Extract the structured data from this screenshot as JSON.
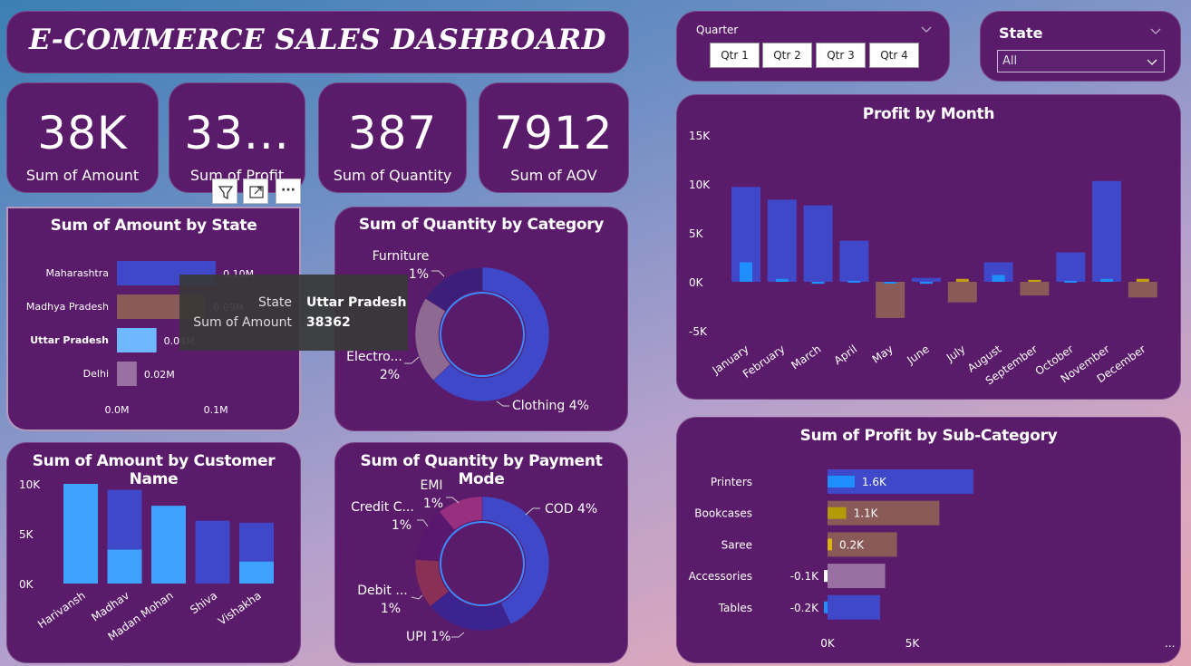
{
  "title": "E-COMMERCE SALES DASHBOARD",
  "kpis": [
    {
      "value": "38K",
      "label": "Sum of Amount"
    },
    {
      "value": "33...",
      "label": "Sum of Profit"
    },
    {
      "value": "387",
      "label": "Sum of Quantity"
    },
    {
      "value": "7912",
      "label": "Sum of AOV"
    }
  ],
  "slicers": {
    "quarter": {
      "label": "Quarter",
      "options": [
        "Qtr 1",
        "Qtr 2",
        "Qtr 3",
        "Qtr 4"
      ]
    },
    "state": {
      "label": "State",
      "selected": "All"
    }
  },
  "visual_header": {
    "icons": [
      "filter-icon",
      "focus-mode-icon",
      "more-options-icon"
    ],
    "more_glyph": "···"
  },
  "tooltip": {
    "k1": "State",
    "v1": "Uttar Pradesh",
    "k2": "Sum of Amount",
    "v2": "38362"
  },
  "accent_colors": {
    "card": "#5a1b6b",
    "bar_blue": "#3f48c9",
    "bar_light": "#40a2ff",
    "bar_brown": "#8a5a58",
    "bar_gold": "#b59a08"
  },
  "chart_data": [
    {
      "id": "amount_by_state",
      "type": "bar",
      "title": "Sum of Amount by State",
      "categories": [
        "Maharashtra",
        "Madhya Pradesh",
        "Uttar Pradesh",
        "Delhi"
      ],
      "values": [
        0.1,
        0.09,
        0.04,
        0.02
      ],
      "data_labels": [
        "0.10M",
        "0.09M",
        "0.04M",
        "0.02M"
      ],
      "highlighted": "Uttar Pradesh",
      "xticks": [
        "0.0M",
        "0.1M"
      ],
      "xlim": [
        0,
        0.11
      ]
    },
    {
      "id": "quantity_by_category",
      "type": "pie",
      "title": "Sum of Quantity by Category",
      "slices": [
        {
          "label": "Clothing",
          "pct": "4%",
          "value": 63,
          "color": "#3f48c9"
        },
        {
          "label": "Electro...",
          "pct": "2%",
          "value": 21,
          "color": "#8e6a92"
        },
        {
          "label": "Furniture",
          "pct": "1%",
          "value": 16,
          "color": "#3d1f7a"
        }
      ]
    },
    {
      "id": "profit_by_month",
      "type": "bar",
      "title": "Profit by Month",
      "categories": [
        "January",
        "February",
        "March",
        "April",
        "May",
        "June",
        "July",
        "August",
        "September",
        "October",
        "November",
        "December"
      ],
      "series": [
        {
          "values": [
            9700,
            8400,
            7800,
            4200,
            -3700,
            400,
            -2100,
            2000,
            -1400,
            3000,
            10300,
            -1600
          ]
        },
        {
          "values": [
            2000,
            300,
            -200,
            100,
            0,
            -200,
            300,
            700,
            200,
            100,
            300,
            300
          ]
        }
      ],
      "yticks": [
        "15K",
        "10K",
        "5K",
        "0K",
        "-5K"
      ],
      "ylim": [
        -5000,
        15000
      ]
    },
    {
      "id": "amount_by_customer",
      "type": "bar",
      "title": "Sum of Amount by Customer Name",
      "categories": [
        "Harivansh",
        "Madhav",
        "Madan Mohan",
        "Shiva",
        "Vishakha"
      ],
      "series": [
        {
          "values": [
            10000,
            9400,
            7800,
            6300,
            6100
          ]
        },
        {
          "values": [
            10000,
            3400,
            7800,
            0,
            2200
          ]
        }
      ],
      "yticks": [
        "10K",
        "5K",
        "0K"
      ],
      "ylim": [
        0,
        10000
      ]
    },
    {
      "id": "quantity_by_payment_mode",
      "type": "pie",
      "title": "Sum of Quantity by Payment Mode",
      "slices": [
        {
          "label": "COD",
          "pct": "4%",
          "value": 43,
          "color": "#3f48c9"
        },
        {
          "label": "UPI",
          "pct": "1%",
          "value": 21,
          "color": "#3b2390"
        },
        {
          "label": "Debit ...",
          "pct": "1%",
          "value": 12,
          "color": "#8a2f55"
        },
        {
          "label": "Credit C...",
          "pct": "1%",
          "value": 13,
          "color": "#5a176e"
        },
        {
          "label": "EMI",
          "pct": "1%",
          "value": 11,
          "color": "#98307f"
        }
      ]
    },
    {
      "id": "profit_by_subcategory",
      "type": "bar",
      "title": "Sum of Profit by Sub-Category",
      "categories": [
        "Printers",
        "Bookcases",
        "Saree",
        "Accessories",
        "Tables"
      ],
      "values": [
        1600,
        1100,
        200,
        -100,
        -200
      ],
      "data_labels": [
        "1.6K",
        "1.1K",
        "0.2K",
        "-0.1K",
        "-0.2K"
      ],
      "background_values": [
        8600,
        6600,
        4100,
        3400,
        3100
      ],
      "xticks": [
        "0K",
        "5K"
      ],
      "xlim": [
        0,
        10000
      ],
      "more": "..."
    }
  ]
}
